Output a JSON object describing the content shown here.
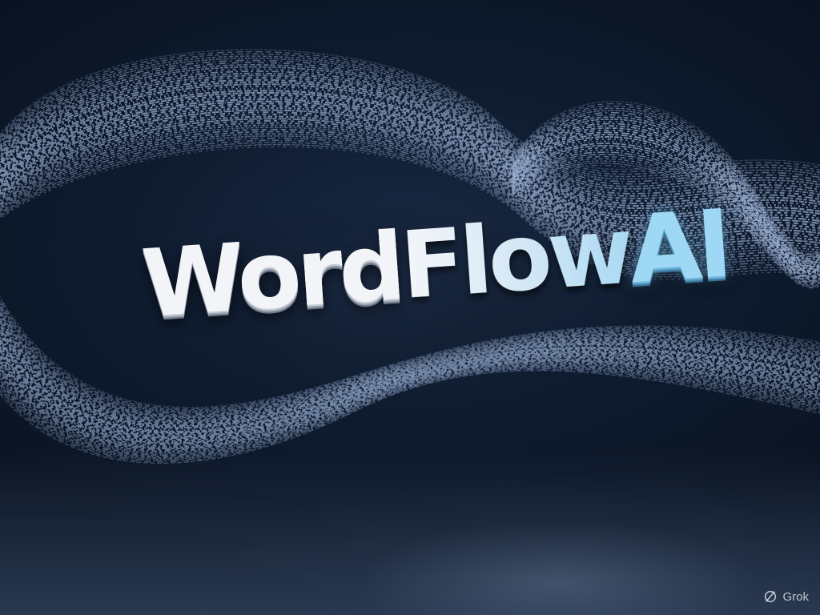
{
  "logo": {
    "part_word": "Word",
    "part_flow": "Flow",
    "part_ai": "AI"
  },
  "watermark": {
    "label": "Grok",
    "icon": "grok-logo-icon"
  },
  "colors": {
    "background": "#0f1c30",
    "ribbon": "#7f93b3",
    "logo_white": "#f2f4f7",
    "logo_accent": "#9fd8f5"
  }
}
